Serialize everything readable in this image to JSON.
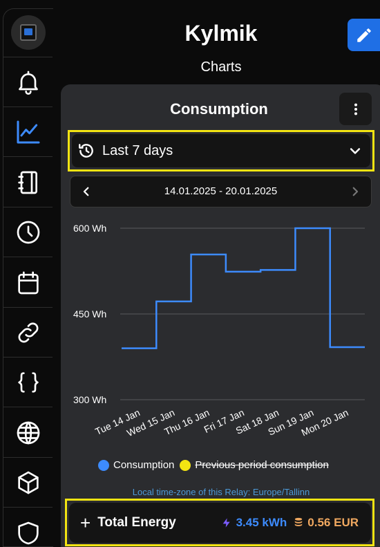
{
  "header": {
    "title": "Kylmik",
    "subtitle": "Charts"
  },
  "sidebar": {
    "items": [
      {
        "icon": "device-avatar"
      },
      {
        "icon": "bell-icon"
      },
      {
        "icon": "chart-icon",
        "active": true
      },
      {
        "icon": "notebook-icon"
      },
      {
        "icon": "clock-icon"
      },
      {
        "icon": "calendar-icon"
      },
      {
        "icon": "link-icon"
      },
      {
        "icon": "code-braces-icon"
      },
      {
        "icon": "globe-icon"
      },
      {
        "icon": "cube-icon"
      },
      {
        "icon": "shield-icon"
      }
    ]
  },
  "card": {
    "title": "Consumption",
    "range_label": "Last 7 days",
    "date_range": "14.01.2025 - 20.01.2025",
    "timezone_note": "Local time-zone of this Relay: Europe/Tallinn"
  },
  "legend": {
    "consumption": "Consumption",
    "previous": "Previous period consumption"
  },
  "totals": {
    "plus": "+",
    "label": "Total Energy",
    "kwh": "3.45 kWh",
    "eur": "0.56 EUR"
  },
  "colors": {
    "accent": "#1f6fe5",
    "series": "#3d8bfd",
    "previous": "#f3e412",
    "highlight": "#f3e412",
    "money": "#f0a860"
  },
  "chart_data": {
    "type": "line",
    "step": true,
    "categories": [
      "Tue 14 Jan",
      "Wed 15 Jan",
      "Thu 16 Jan",
      "Fri 17 Jan",
      "Sat 18 Jan",
      "Sun 19 Jan",
      "Mon 20 Jan"
    ],
    "series": [
      {
        "name": "Consumption",
        "values": [
          390,
          472,
          554,
          524,
          527,
          600,
          392
        ]
      },
      {
        "name": "Previous period consumption",
        "values": [],
        "hidden": true
      }
    ],
    "yticks": [
      "300 Wh",
      "450 Wh",
      "600 Wh"
    ],
    "yvals": [
      300,
      450,
      600
    ],
    "ylim": [
      300,
      600
    ],
    "grid": true
  }
}
